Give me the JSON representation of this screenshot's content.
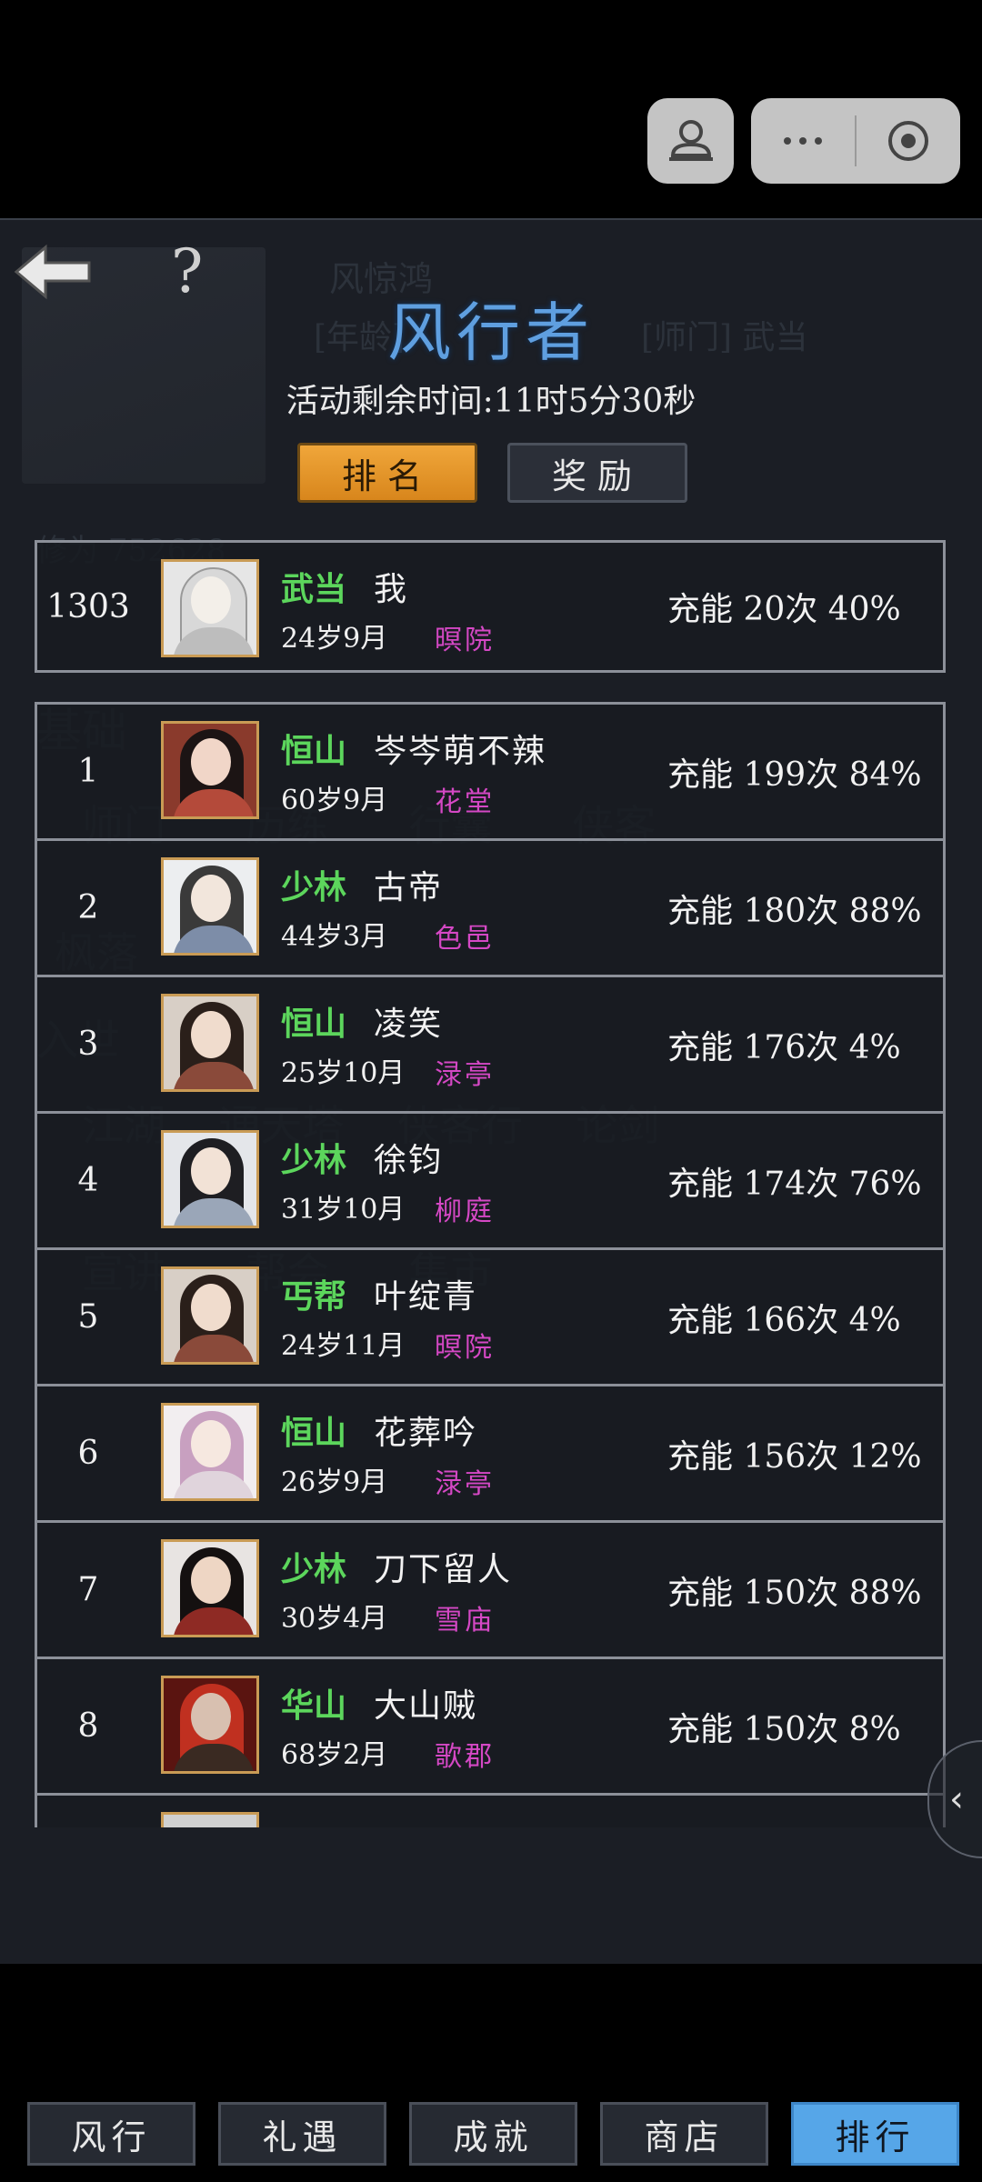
{
  "title": "风行者",
  "timer": "活动剩余时间:11时5分30秒",
  "tabs": {
    "rank": "排名",
    "reward": "奖励"
  },
  "icons": {
    "back": "back-arrow-icon",
    "help": "question-mark-icon"
  },
  "colors": {
    "sect": "#5cd65c",
    "location": "#d548c5",
    "active_tab": "#e99a2c",
    "active_nav": "#56a6e8",
    "title": "#5f9fe0"
  },
  "my_row": {
    "rank": "1303",
    "sect": "武当",
    "name": "我",
    "age": "24岁9月",
    "location": "暝院",
    "charge": "充能 20次 40%"
  },
  "rows": [
    {
      "rank": "1",
      "sect": "恒山",
      "name": "岑岑萌不辣",
      "age": "60岁9月",
      "location": "花堂",
      "charge": "充能 199次 84%"
    },
    {
      "rank": "2",
      "sect": "少林",
      "name": "古帝",
      "age": "44岁3月",
      "location": "色邑",
      "charge": "充能 180次 88%"
    },
    {
      "rank": "3",
      "sect": "恒山",
      "name": "凌笑",
      "age": "25岁10月",
      "location": "渌亭",
      "charge": "充能 176次 4%"
    },
    {
      "rank": "4",
      "sect": "少林",
      "name": "徐钧",
      "age": "31岁10月",
      "location": "柳庭",
      "charge": "充能 174次 76%"
    },
    {
      "rank": "5",
      "sect": "丐帮",
      "name": "叶绽青",
      "age": "24岁11月",
      "location": "暝院",
      "charge": "充能 166次 4%"
    },
    {
      "rank": "6",
      "sect": "恒山",
      "name": "花葬吟",
      "age": "26岁9月",
      "location": "渌亭",
      "charge": "充能 156次 12%"
    },
    {
      "rank": "7",
      "sect": "少林",
      "name": "刀下留人",
      "age": "30岁4月",
      "location": "雪庙",
      "charge": "充能 150次 88%"
    },
    {
      "rank": "8",
      "sect": "华山",
      "name": "大山贼",
      "age": "68岁2月",
      "location": "歌郡",
      "charge": "充能 150次 8%"
    }
  ],
  "nav": [
    "风行",
    "礼遇",
    "成就",
    "商店",
    "排行"
  ],
  "nav_active": "排行"
}
